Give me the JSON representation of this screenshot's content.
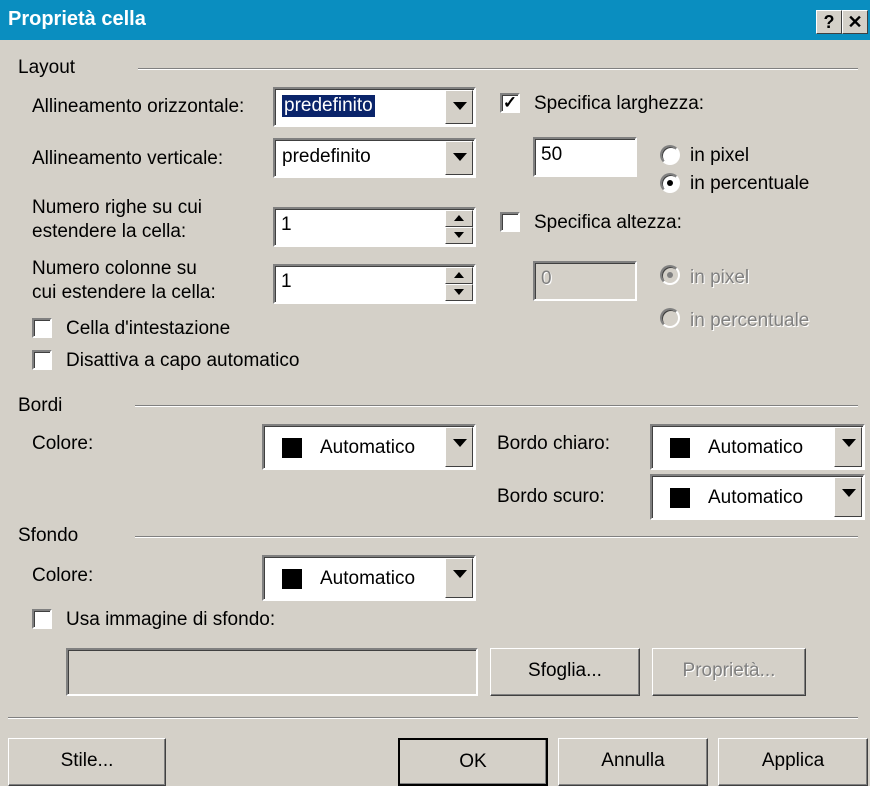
{
  "window": {
    "title": "Proprietà cella",
    "help_label": "?",
    "close_label": "✕"
  },
  "layout": {
    "section_label": "Layout",
    "horiz_align": {
      "label": "Allineamento orizzontale:",
      "value": "predefinito"
    },
    "vert_align": {
      "label": "Allineamento verticale:",
      "value": "predefinito"
    },
    "rows_span": {
      "label_line1": "Numero righe su cui",
      "label_line2": "estendere la cella:",
      "value": "1"
    },
    "cols_span": {
      "label_line1": "Numero colonne su",
      "label_line2": "cui estendere la cella:",
      "value": "1"
    },
    "header_cell": {
      "label": "Cella d'intestazione",
      "checked": false
    },
    "no_wrap": {
      "label": "Disattiva a capo automatico",
      "checked": false
    },
    "width": {
      "label": "Specifica larghezza:",
      "checked": true,
      "value": "50",
      "unit_pixel": "in pixel",
      "unit_percent": "in percentuale",
      "selected_unit": "percent"
    },
    "height": {
      "label": "Specifica altezza:",
      "checked": false,
      "value": "0",
      "unit_pixel": "in pixel",
      "unit_percent": "in percentuale",
      "selected_unit": "pixel"
    }
  },
  "borders": {
    "section_label": "Bordi",
    "color": {
      "label": "Colore:",
      "value": "Automatico",
      "swatch": "#000000"
    },
    "light": {
      "label": "Bordo chiaro:",
      "value": "Automatico",
      "swatch": "#000000"
    },
    "dark": {
      "label": "Bordo scuro:",
      "value": "Automatico",
      "swatch": "#000000"
    }
  },
  "background": {
    "section_label": "Sfondo",
    "color": {
      "label": "Colore:",
      "value": "Automatico",
      "swatch": "#000000"
    },
    "use_image": {
      "label": "Usa immagine di sfondo:",
      "checked": false
    },
    "image_path": "",
    "browse_label": "Sfoglia...",
    "properties_label": "Proprietà..."
  },
  "footer": {
    "style_label": "Stile...",
    "ok_label": "OK",
    "cancel_label": "Annulla",
    "apply_label": "Applica"
  },
  "colors": {
    "titlebar": "#0a8ec0",
    "face": "#d4d0c8",
    "selection": "#0a246a"
  }
}
